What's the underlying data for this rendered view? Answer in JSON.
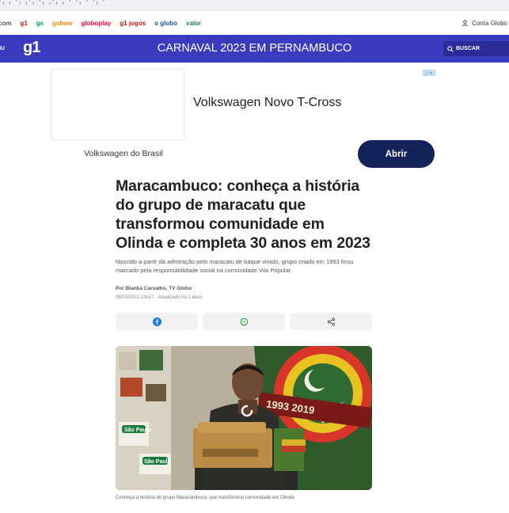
{
  "nav": {
    "links": [
      {
        "label": "com",
        "color": "#555555"
      },
      {
        "label": "g1",
        "color": "#c4170c"
      },
      {
        "label": "ge",
        "color": "#06aa48"
      },
      {
        "label": "gshow",
        "color": "#ff7f00"
      },
      {
        "label": "globoplay",
        "color": "#fb0234"
      },
      {
        "label": "g1 jogos",
        "color": "#c4170c"
      },
      {
        "label": "o globo",
        "color": "#1e5199"
      },
      {
        "label": "valor",
        "color": "#1e7a55"
      }
    ],
    "account_label": "Conta Globo"
  },
  "header": {
    "menu_label": "NU",
    "logo": "g1",
    "section_title": "CARNAVAL 2023 EM PERNAMBUCO",
    "search_label": "BUSCAR",
    "bar_color": "#3b3bbf"
  },
  "ad": {
    "headline": "Volkswagen Novo T-Cross",
    "advertiser": "Volkswagen do Brasil",
    "cta_label": "Abrir"
  },
  "article": {
    "title": "Maracambuco: conheça a história do grupo de maracatu que transformou comunidade em Olinda e completa 30 anos em 2023",
    "subtitle": "Nascido a partir da admiração pelo maracatu de baque virado, grupo criado em 1993 ficou marcado pela responsabilidade social na comunidade Vila Popular.",
    "byline": "Por Bianka Carvalho, TV Globo",
    "dates": "08/02/2023 13h17 · Atualizado há 2 anos",
    "share_buttons": [
      "facebook-icon",
      "whatsapp-icon",
      "share-icon"
    ],
    "photo_text": {
      "years": "1993   2019",
      "sign1": "São Paulo",
      "sign2": "São Paulo"
    },
    "caption": "Conheça a história do grupo Maracambuco, que transformou comunidade em Olinda"
  }
}
